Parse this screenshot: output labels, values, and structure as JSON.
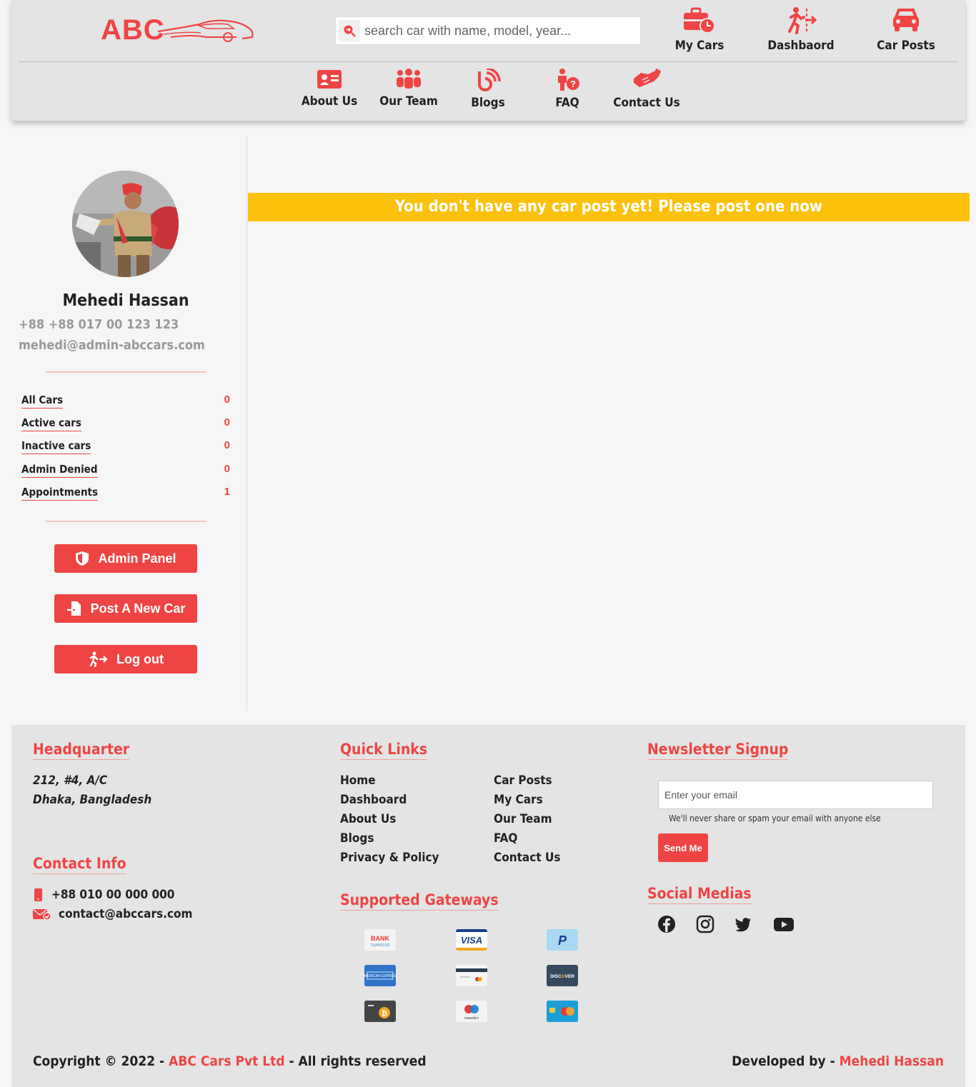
{
  "header": {
    "logo_text": "ABC",
    "search_placeholder": "search car with name, model, year...",
    "top_nav": [
      {
        "label": "My Cars",
        "icon": "briefcase-clock-icon"
      },
      {
        "label": "Dashbaord",
        "icon": "exit-runner-icon"
      },
      {
        "label": "Car Posts",
        "icon": "car-icon"
      }
    ],
    "nav": [
      {
        "label": "About Us",
        "icon": "id-card-icon"
      },
      {
        "label": "Our Team",
        "icon": "users-icon"
      },
      {
        "label": "Blogs",
        "icon": "blog-icon"
      },
      {
        "label": "FAQ",
        "icon": "person-question-icon"
      },
      {
        "label": "Contact Us",
        "icon": "handshake-icon"
      }
    ]
  },
  "profile": {
    "name": "Mehedi Hassan",
    "phone": "+88 +88 017 00 123 123",
    "email": "mehedi@admin-abccars.com"
  },
  "stats": [
    {
      "label": "All Cars",
      "count": "0"
    },
    {
      "label": "Active cars",
      "count": "0"
    },
    {
      "label": "Inactive cars",
      "count": "0"
    },
    {
      "label": "Admin Denied",
      "count": "0"
    },
    {
      "label": "Appointments",
      "count": "1"
    }
  ],
  "buttons": {
    "admin_panel": "Admin Panel",
    "post_car": "Post A New Car",
    "logout": "Log out"
  },
  "main": {
    "notice": "You don't have any car post yet! Please post one now"
  },
  "footer": {
    "headquarter_title": "Headquarter",
    "address_line1": "212, #4, A/C",
    "address_line2": "Dhaka, Bangladesh",
    "contact_title": "Contact Info",
    "contact_phone": "+88 010 00 000 000",
    "contact_email": "contact@abccars.com",
    "quick_links_title": "Quick Links",
    "quick_links_col1": [
      "Home",
      "Dashboard",
      "About Us",
      "Blogs",
      "Privacy & Policy"
    ],
    "quick_links_col2": [
      "Car Posts",
      "My Cars",
      "Our Team",
      "FAQ",
      "Contact Us"
    ],
    "gateways_title": "Supported Gateways",
    "gateways": [
      "bank-transfer",
      "visa",
      "paypal",
      "american-express",
      "generic-card",
      "discover",
      "bitcoin",
      "maestro",
      "mastercard"
    ],
    "newsletter_title": "Newsletter Signup",
    "newsletter_placeholder": "Enter your email",
    "newsletter_help": "We'll never share or spam your email with anyone else",
    "newsletter_button": "Send Me",
    "social_title": "Social Medias",
    "social": [
      "facebook-icon",
      "instagram-icon",
      "twitter-icon",
      "youtube-icon"
    ],
    "copyright_prefix": "Copyright © 2022 - ",
    "copyright_company": "ABC Cars Pvt Ltd",
    "copyright_suffix": " - All rights reserved",
    "developed_prefix": "Developed by - ",
    "developer": "Mehedi Hassan"
  },
  "colors": {
    "accent": "#ef4444",
    "warning": "#fcc10c",
    "panel": "#e4e4e4"
  }
}
